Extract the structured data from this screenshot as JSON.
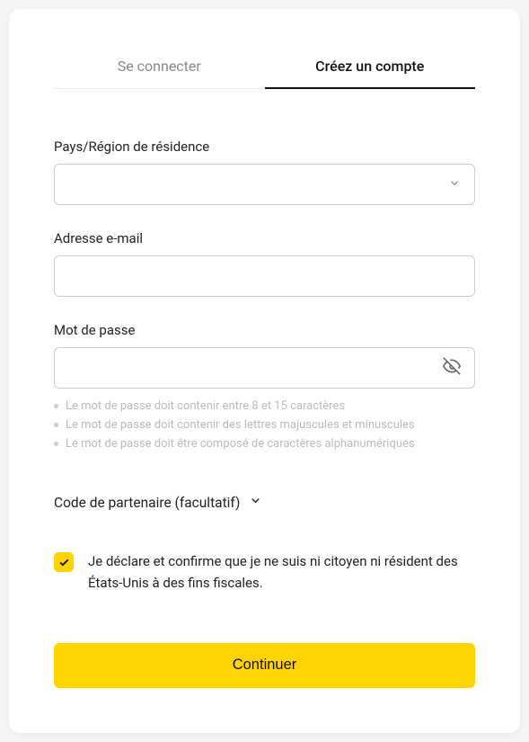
{
  "tabs": {
    "login": "Se connecter",
    "signup": "Créez un compte"
  },
  "fields": {
    "country_label": "Pays/Région de résidence",
    "country_value": "",
    "email_label": "Adresse e-mail",
    "email_value": "",
    "password_label": "Mot de passe",
    "password_value": ""
  },
  "password_hints": [
    "Le mot de passe doit contenir entre 8 et 15 caractères",
    "Le mot de passe doit contenir des lettres majuscules et minuscules",
    "Le mot de passe doit être composé de caractères alphanumériques"
  ],
  "partner_code_label": "Code de partenaire (facultatif)",
  "declaration_text": "Je déclare et confirme que je ne suis ni citoyen ni résident des États-Unis à des fins fiscales.",
  "submit_label": "Continuer"
}
